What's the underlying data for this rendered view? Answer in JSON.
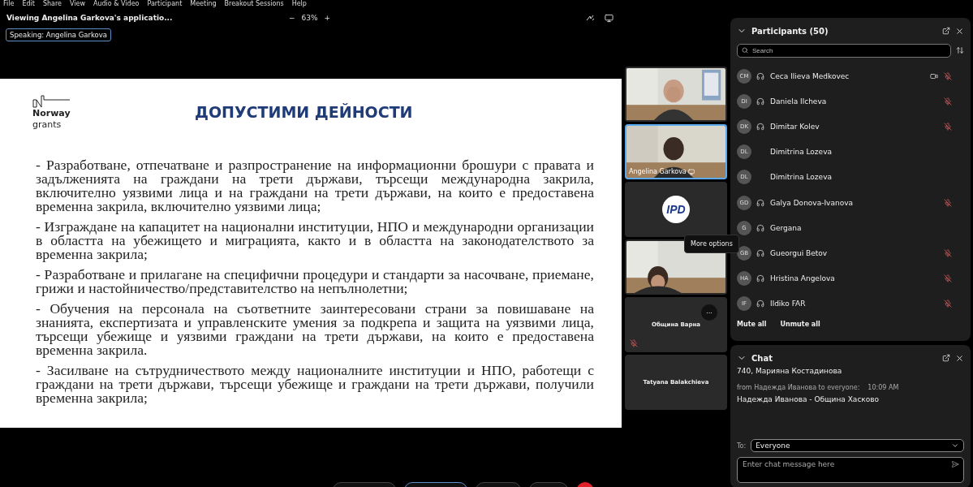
{
  "menu": [
    "File",
    "Edit",
    "Share",
    "View",
    "Audio & Video",
    "Participant",
    "Meeting",
    "Breakout Sessions",
    "Help"
  ],
  "share_bar": {
    "title": "Viewing Angelina Garkova's applicatio...",
    "zoom_out": "−",
    "zoom": "63%",
    "zoom_in": "+"
  },
  "speaking": "Speaking: Angelina Garkova",
  "slide": {
    "logo_line1": "Norway",
    "logo_line2": "grants",
    "title": "ДОПУСТИМИ ДЕЙНОСТИ",
    "bullets": [
      "- Разработване, отпечатване и разпространение на информационни брошури с правата и задълженията на граждани на трети държави, търсещи международна закрила, включително уязвими лица и на граждани на трети държави, на които е предоставена временна закрила, включително уязвими лица;",
      "- Изграждане на капацитет на национални институции, НПО и международни организации в областта на убежището и миграцията, както и в областта на законодателството за временна закрила;",
      "- Разработване и прилагане на специфични процедури и стандарти за насочване, приемане, грижи и настойничество/представителство на непълнолетни;",
      "- Обучения на персонала на съответните заинтересовани страни за повишаване на знанията, експертизата и управленските умения за подкрепа и защита на уязвими лица, търсещи убежище и уязвими граждани на трети държави, на които е предоставена временна закрила.",
      "- Засилване на сътрудничеството между националните институции и НПО, работещи с граждани на трети държави, търсещи убежище и граждани на трети държави, получили временна закрила;"
    ]
  },
  "videos": [
    {
      "kind": "camera",
      "selected": false,
      "muted": false
    },
    {
      "kind": "camera",
      "name": "Angelina Garkova",
      "selected": true,
      "muted": false
    },
    {
      "kind": "logo",
      "logo": "IPD",
      "selected": false,
      "muted": false
    },
    {
      "kind": "camera",
      "selected": false,
      "muted": false
    },
    {
      "kind": "name",
      "name": "Община Варна",
      "more": "···",
      "selected": false,
      "muted": true
    },
    {
      "kind": "name",
      "name": "Tatyana Balakchieva",
      "selected": false,
      "muted": false
    }
  ],
  "tooltip": "More options",
  "participants": {
    "title": "Participants (50)",
    "search_placeholder": "Search",
    "items": [
      {
        "initials": "CM",
        "name": "Ceca Ilieva Medkovec",
        "audio": true,
        "video": true,
        "muted": true
      },
      {
        "initials": "DI",
        "name": "Daniela Ilcheva",
        "audio": true,
        "video": false,
        "muted": true
      },
      {
        "initials": "DK",
        "name": "Dimitar Kolev",
        "audio": true,
        "video": false,
        "muted": true
      },
      {
        "initials": "DL",
        "name": "Dimitrina Lozeva",
        "audio": false,
        "video": false,
        "muted": false
      },
      {
        "initials": "DL",
        "name": "Dimitrina Lozeva",
        "audio": false,
        "video": false,
        "muted": false
      },
      {
        "initials": "GD",
        "name": "Galya Donova-Ivanova",
        "audio": true,
        "video": false,
        "muted": true
      },
      {
        "initials": "G",
        "name": "Gergana",
        "audio": true,
        "video": false,
        "muted": false
      },
      {
        "initials": "GB",
        "name": "Gueorgui Betov",
        "audio": true,
        "video": false,
        "muted": true
      },
      {
        "initials": "HA",
        "name": "Hristina Angelova",
        "audio": true,
        "video": false,
        "muted": true
      },
      {
        "initials": "IF",
        "name": "Ildiko FAR",
        "audio": true,
        "video": false,
        "muted": true
      }
    ],
    "actions": [
      "Mute all",
      "Unmute all"
    ]
  },
  "chat": {
    "title": "Chat",
    "messages": [
      {
        "kind": "text",
        "text": "740, Марияна Костадинова"
      },
      {
        "kind": "header",
        "from": "from Надежда Иванова to everyone:",
        "time": "10:09 AM"
      },
      {
        "kind": "text",
        "text": "Надежда Иванова - Община Хасково"
      }
    ],
    "to_label": "To:",
    "recipient": "Everyone",
    "placeholder": "Enter chat message here"
  }
}
